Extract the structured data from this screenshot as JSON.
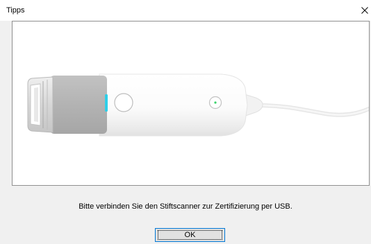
{
  "window": {
    "title": "Tipps"
  },
  "content": {
    "illustration": "pen-scanner-usb-illustration",
    "message": "Bitte verbinden Sie den Stiftscanner zur Zertifizierung per USB."
  },
  "buttons": {
    "ok_label": "OK"
  },
  "colors": {
    "accent": "#0078d7",
    "led": "#2ecfe8",
    "grip": "#b4b4b4"
  }
}
